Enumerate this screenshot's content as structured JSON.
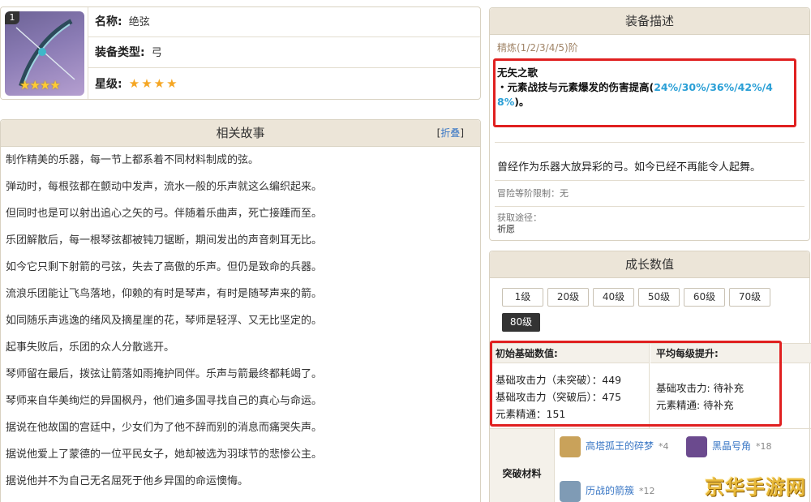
{
  "info": {
    "badge": "1",
    "thumb_stars": "★★★★",
    "name_label": "名称:",
    "name_value": "绝弦",
    "type_label": "装备类型:",
    "type_value": "弓",
    "star_label": "星级:",
    "star_value": "★★★★"
  },
  "story": {
    "title": "相关故事",
    "fold_label": "折叠",
    "lines": [
      "制作精美的乐器，每一节上都系着不同材料制成的弦。",
      "弹动时，每根弦都在颤动中发声，流水一般的乐声就这么编织起来。",
      "但同时也是可以射出追心之矢的弓。伴随着乐曲声，死亡接踵而至。",
      "乐团解散后，每一根琴弦都被钝刀锯断，期间发出的声音刺耳无比。",
      "如今它只剩下射箭的弓弦，失去了高傲的乐声。但仍是致命的兵器。",
      "流浪乐团能让飞鸟落地，仰赖的有时是琴声，有时是随琴声来的箭。",
      "如同随乐声逃逸的绪风及摘星崖的花，琴师是轻浮、又无比坚定的。",
      "起事失败后，乐团的众人分散逃开。",
      "琴师留在最后，拨弦让箭落如雨掩护同伴。乐声与箭最终都耗竭了。",
      "琴师来自华美绚烂的异国枫丹，他们遍多国寻找自己的真心与命运。",
      "据说在他故国的宫廷中，少女们为了他不辞而别的消息而痛哭失声。",
      "据说他爱上了蒙德的一位平民女子，她却被选为羽球节的悲惨公主。",
      "据说他并不为自己无名屈死于他乡异国的命运懊悔。"
    ]
  },
  "desc": {
    "title": "装备描述",
    "refine": "精炼(1/2/3/4/5)阶",
    "skill_title": "无矢之歌",
    "skill_text": "・元素战技与元素爆发的伤害提高(",
    "skill_values": "24%/30%/36%/42%/48%",
    "skill_end": ")。",
    "flavor": "曾经作为乐器大放异彩的弓。如今已经不再能令人起舞。",
    "rank_limit": "冒险等阶限制：无",
    "source_label": "获取途径：",
    "source_value": "祈愿"
  },
  "growth": {
    "title": "成长数值",
    "levels": [
      "1级",
      "20级",
      "40级",
      "50级",
      "60级",
      "70级",
      "80级"
    ],
    "active_level": "80级",
    "base_header": "初始基础数值:",
    "base_lines": [
      "基础攻击力（未突破）：449",
      "基础攻击力（突破后）：475",
      "元素精通：151"
    ],
    "per_header": "平均每级提升:",
    "per_lines": [
      "基础攻击力: 待补充",
      "元素精通: 待补充"
    ],
    "mats_label": "突破材料",
    "materials": [
      {
        "name": "高塔孤王的碎梦",
        "count": "*4",
        "color": "#c9a25a"
      },
      {
        "name": "黑晶号角",
        "count": "*18",
        "color": "#6b4a8e"
      },
      {
        "name": "历战的箭簇",
        "count": "*12",
        "color": "#7f9bb5"
      }
    ]
  },
  "watermark": "京华手游网"
}
